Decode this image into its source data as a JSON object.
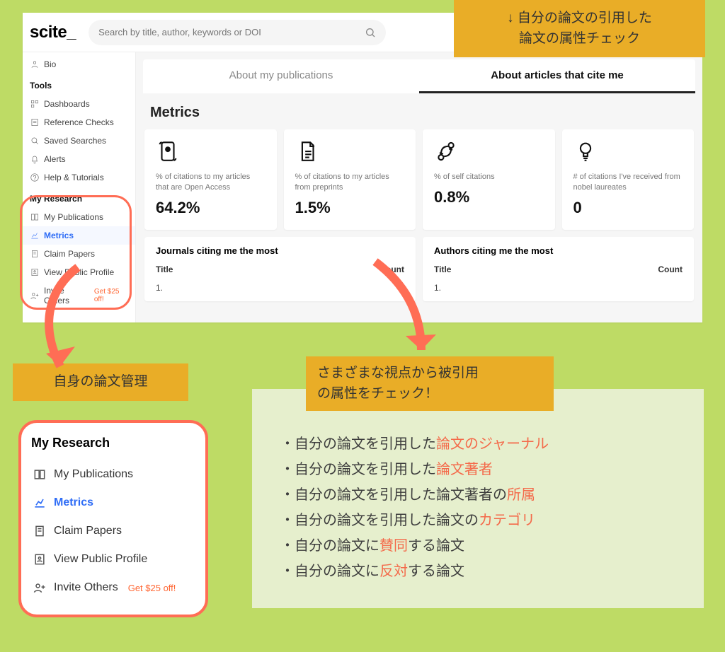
{
  "brand": "scite",
  "search": {
    "placeholder": "Search by title, author, keywords or DOI"
  },
  "sidebar": {
    "bio_item": "Bio",
    "tools_label": "Tools",
    "tools": [
      {
        "label": "Dashboards"
      },
      {
        "label": "Reference Checks"
      },
      {
        "label": "Saved Searches"
      },
      {
        "label": "Alerts"
      },
      {
        "label": "Help & Tutorials"
      }
    ],
    "research_label": "My Research",
    "research": [
      {
        "label": "My Publications"
      },
      {
        "label": "Metrics",
        "active": true
      },
      {
        "label": "Claim Papers"
      },
      {
        "label": "View Public Profile"
      },
      {
        "label": "Invite Others",
        "extra": "Get $25 off!"
      }
    ]
  },
  "tabs": {
    "about_mine": "About my publications",
    "cite_me": "About articles that cite me"
  },
  "metrics": {
    "heading": "Metrics",
    "cards": [
      {
        "label": "% of citations to my articles that are Open Access",
        "value": "64.2%"
      },
      {
        "label": "% of citations to my articles from preprints",
        "value": "1.5%"
      },
      {
        "label": "% of self citations",
        "value": "0.8%"
      },
      {
        "label": "# of citations I've received from nobel laureates",
        "value": "0"
      }
    ]
  },
  "tables": {
    "journals": {
      "title": "Journals citing me the most",
      "col1": "Title",
      "col2": "Count",
      "row1": "1."
    },
    "authors": {
      "title": "Authors citing me the most",
      "col1": "Title",
      "col2": "Count",
      "row1": "1."
    }
  },
  "annotations": {
    "top": "↓ 自分の論文の引用した\n論文の属性チェック",
    "left": "自身の論文管理",
    "mid": "さまざまな視点から被引用\nの属性をチェック！"
  },
  "enlarged": {
    "heading": "My Research",
    "items": [
      {
        "label": "My Publications"
      },
      {
        "label": "Metrics",
        "active": true
      },
      {
        "label": "Claim Papers"
      },
      {
        "label": "View Public Profile"
      },
      {
        "label": "Invite Others",
        "extra": "Get $25 off!"
      }
    ]
  },
  "bullets": [
    {
      "pre": "・自分の論文を引用した",
      "hl": "論文のジャーナル",
      "post": ""
    },
    {
      "pre": "・自分の論文を引用した",
      "hl": "論文著者",
      "post": ""
    },
    {
      "pre": "・自分の論文を引用した論文著者の",
      "hl": "所属",
      "post": ""
    },
    {
      "pre": "・自分の論文を引用した論文の",
      "hl": "カテゴリ",
      "post": ""
    },
    {
      "pre": "・自分の論文に",
      "hl": "賛同",
      "post": "する論文"
    },
    {
      "pre": "・自分の論文に",
      "hl": "反対",
      "post": "する論文"
    }
  ]
}
